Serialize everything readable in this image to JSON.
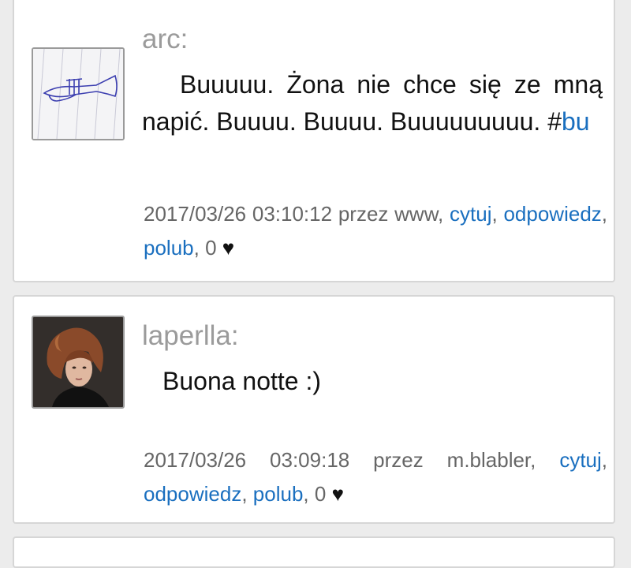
{
  "posts": [
    {
      "author": "arc:",
      "body_text": "Buuuuu. Żona nie chce się ze mną napić. Buuuu. Buuuu. Buuuuuuuuu. #",
      "hashtag": "bu",
      "timestamp": "2017/03/26  03:10:12",
      "via": "przez www,",
      "actions": {
        "quote": "cytuj",
        "reply": "odpowiedz",
        "like": "polub",
        "likes_count": "0"
      },
      "avatar_icon": "trumpet-sketch-icon"
    },
    {
      "author": "laperlla:",
      "body_text": "Buona notte :)",
      "timestamp": "2017/03/26 03:09:18",
      "via": "przez m.blabler,",
      "actions": {
        "quote": "cytuj",
        "reply": "odpowiedz",
        "like": "polub",
        "likes_count": "0"
      },
      "avatar_icon": "woman-portrait-photo"
    }
  ],
  "colors": {
    "link": "#1a6fbf",
    "author": "#9b9b9b",
    "meta": "#666666",
    "border": "#d6d6d6"
  },
  "heart_icon": "♥"
}
